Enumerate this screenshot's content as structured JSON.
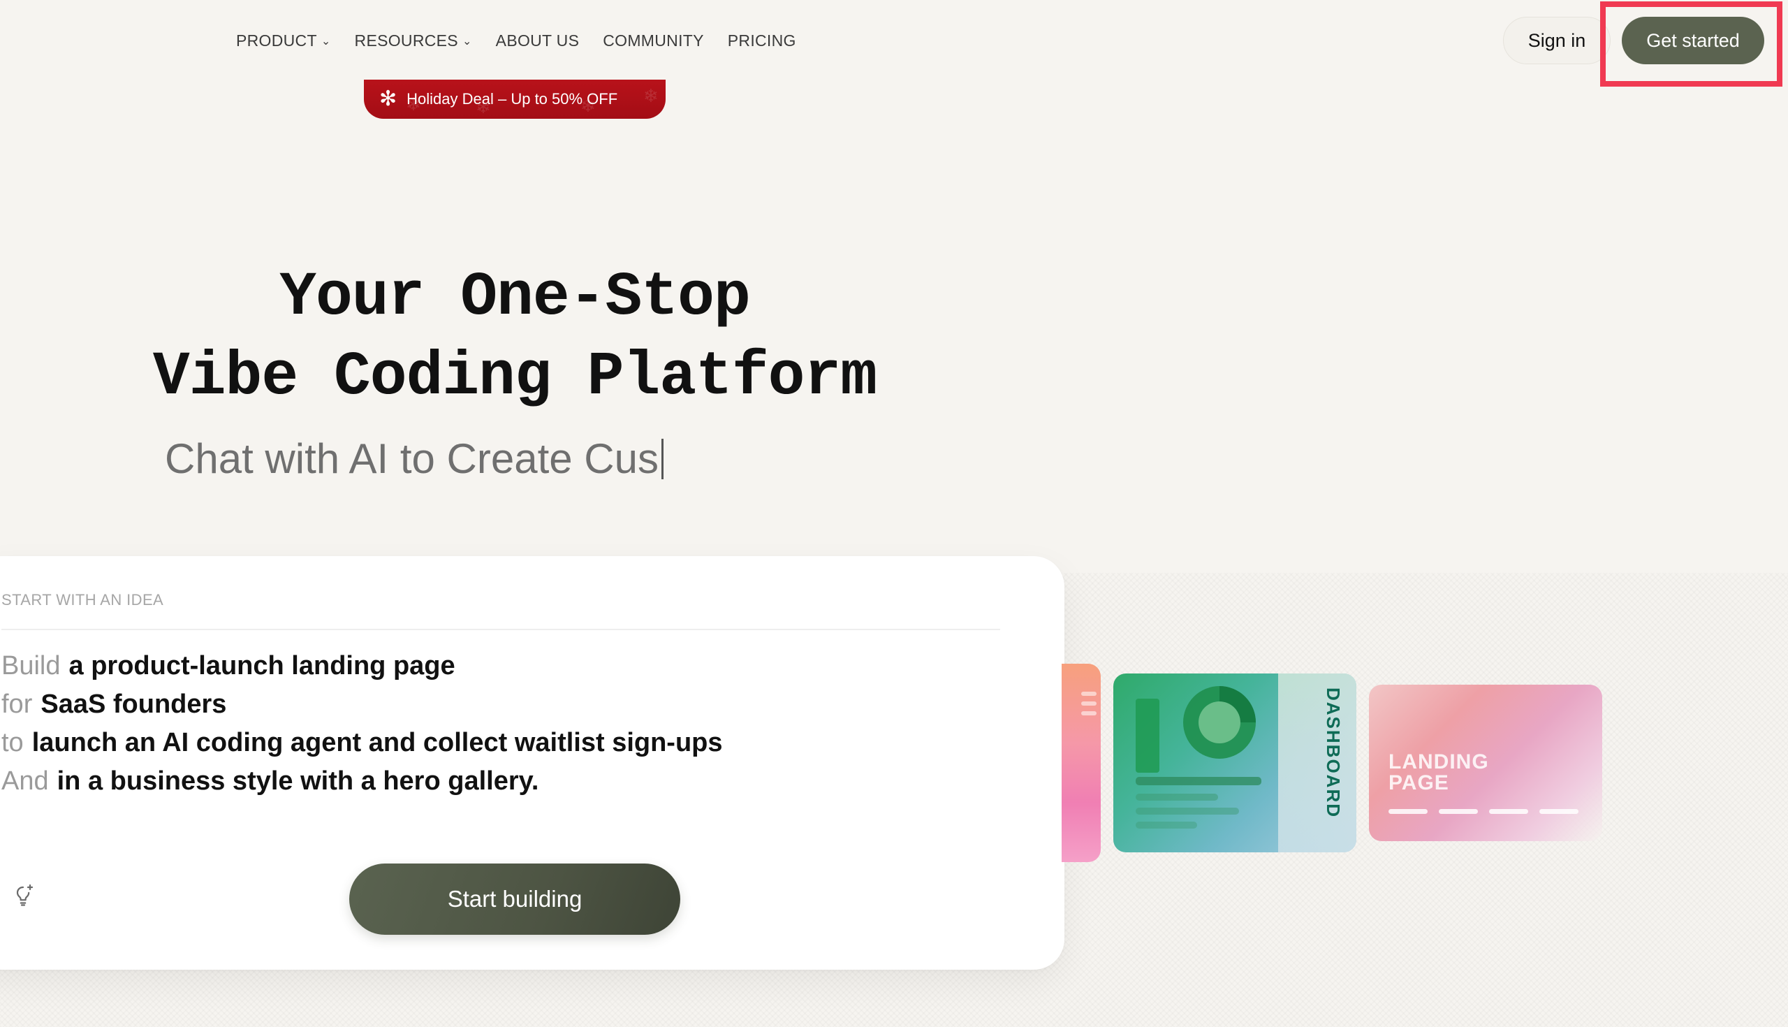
{
  "nav": {
    "items": [
      {
        "label": "PRODUCT",
        "has_dropdown": true
      },
      {
        "label": "RESOURCES",
        "has_dropdown": true
      },
      {
        "label": "ABOUT US",
        "has_dropdown": false
      },
      {
        "label": "COMMUNITY",
        "has_dropdown": false
      },
      {
        "label": "PRICING",
        "has_dropdown": false
      }
    ],
    "sign_in_label": "Sign in",
    "get_started_label": "Get started"
  },
  "promo": {
    "text": "Holiday Deal – Up to 50% OFF",
    "icon": "snowflake-icon",
    "color": "#b8121a"
  },
  "hero": {
    "title_line1": "Your One-Stop",
    "title_line2": "Vibe Coding Platform",
    "subtitle_typed": "Chat with AI to Create Cus"
  },
  "idea_card": {
    "label": "START WITH AN IDEA",
    "lines": [
      {
        "keyword": "Build",
        "value": "a product-launch landing page"
      },
      {
        "keyword": "for",
        "value": "SaaS founders"
      },
      {
        "keyword": "to",
        "value": "launch an AI coding agent and collect waitlist sign-ups"
      },
      {
        "keyword": "And",
        "value": "in a business style with a hero gallery."
      }
    ],
    "idea_icon": "lightbulb-sparkle-icon",
    "cta_label": "Start building"
  },
  "gallery": {
    "dashboard_label": "DASHBOARD",
    "landing_label": "LANDING PAGE"
  },
  "colors": {
    "background": "#f6f4f0",
    "primary_button": "#5b6350",
    "highlight": "#f03a52"
  }
}
